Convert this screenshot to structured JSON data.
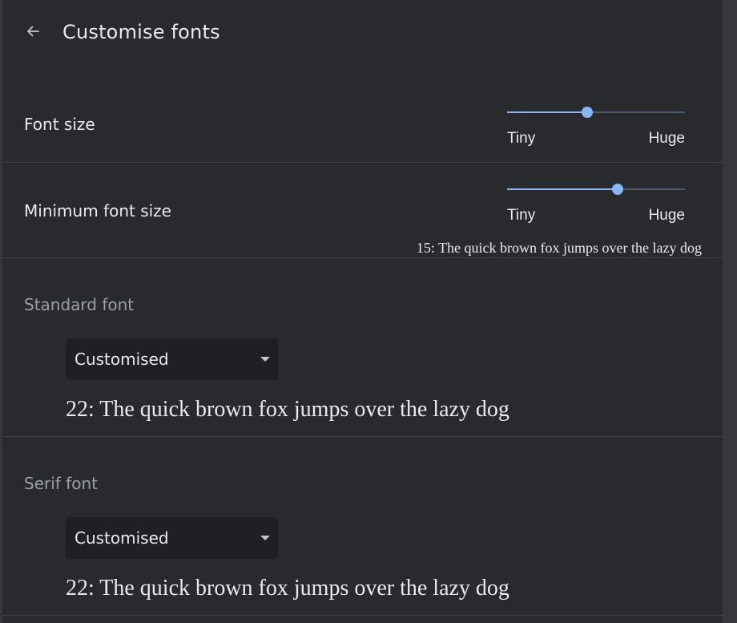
{
  "header": {
    "title": "Customise fonts",
    "back_icon": "arrow-left-icon"
  },
  "font_size": {
    "label": "Font size",
    "min_label": "Tiny",
    "max_label": "Huge",
    "value_fraction": 0.45
  },
  "minimum_font_size": {
    "label": "Minimum font size",
    "min_label": "Tiny",
    "max_label": "Huge",
    "value_fraction": 0.62,
    "preview": "15: The quick brown fox jumps over the lazy dog"
  },
  "standard_font": {
    "title": "Standard font",
    "selected": "Customised",
    "sample": "22: The quick brown fox jumps over the lazy dog"
  },
  "serif_font": {
    "title": "Serif font",
    "selected": "Customised",
    "sample": "22: The quick brown fox jumps over the lazy dog"
  },
  "colors": {
    "page_bg": "#292a2d",
    "accent": "#8ab4f8",
    "secondary_text": "#9aa0a6",
    "select_bg": "#1f2023"
  }
}
